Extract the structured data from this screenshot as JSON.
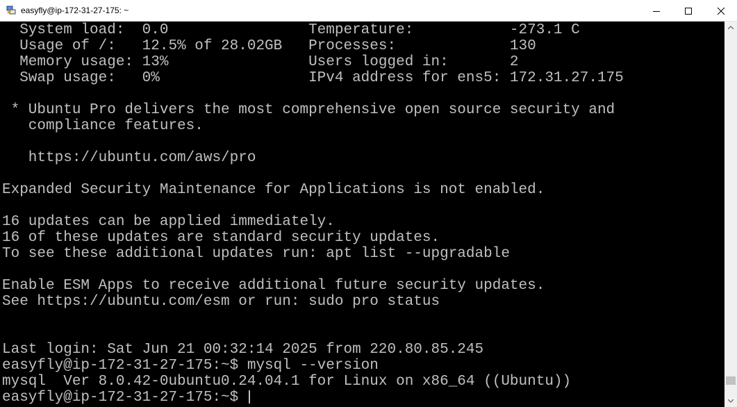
{
  "window": {
    "title": "easyfly@ip-172-31-27-175: ~",
    "app_icon": "putty-icon"
  },
  "terminal": {
    "lines": [
      "  System load:  0.0                Temperature:           -273.1 C",
      "  Usage of /:   12.5% of 28.02GB   Processes:             130",
      "  Memory usage: 13%                Users logged in:       2",
      "  Swap usage:   0%                 IPv4 address for ens5: 172.31.27.175",
      "",
      " * Ubuntu Pro delivers the most comprehensive open source security and",
      "   compliance features.",
      "",
      "   https://ubuntu.com/aws/pro",
      "",
      "Expanded Security Maintenance for Applications is not enabled.",
      "",
      "16 updates can be applied immediately.",
      "16 of these updates are standard security updates.",
      "To see these additional updates run: apt list --upgradable",
      "",
      "Enable ESM Apps to receive additional future security updates.",
      "See https://ubuntu.com/esm or run: sudo pro status",
      "",
      "",
      "Last login: Sat Jun 21 00:32:14 2025 from 220.80.85.245",
      "easyfly@ip-172-31-27-175:~$ mysql --version",
      "mysql  Ver 8.0.42-0ubuntu0.24.04.1 for Linux on x86_64 ((Ubuntu))",
      "easyfly@ip-172-31-27-175:~$ "
    ],
    "text_color": "#c0c0c0",
    "background_color": "#000000"
  },
  "scrollbar": {
    "position_fraction": 0.97
  }
}
